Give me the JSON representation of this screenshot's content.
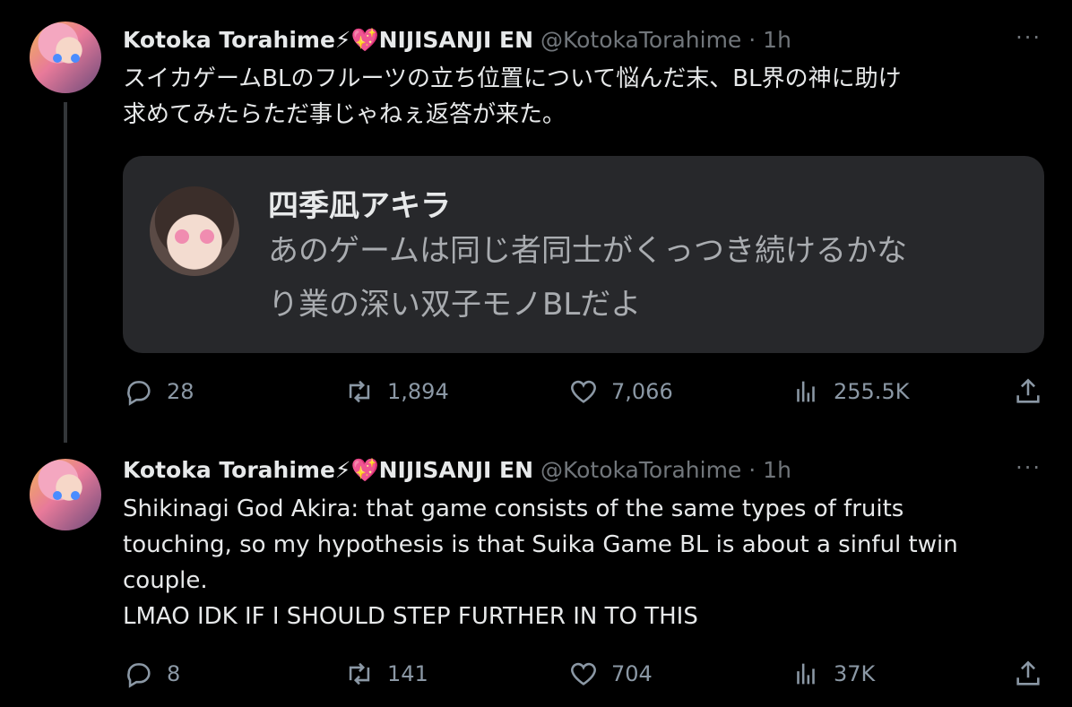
{
  "tweets": [
    {
      "author_name": "Kotoka Torahime⚡💖NIJISANJI EN",
      "handle": "@KotokaTorahime",
      "separator": "·",
      "time": "1h",
      "more": "···",
      "text_lines": [
        "スイカゲームBLのフルーツの立ち位置について悩んだ末、BL界の神に助け",
        "求めてみたらただ事じゃねぇ返答が来た。"
      ],
      "quote": {
        "name": "四季凪アキラ",
        "text_lines": [
          "あのゲームは同じ者同士がくっつき続けるかな",
          "り業の深い双子モノBLだよ"
        ]
      },
      "stats": {
        "replies": "28",
        "retweets": "1,894",
        "likes": "7,066",
        "views": "255.5K"
      }
    },
    {
      "author_name": "Kotoka Torahime⚡💖NIJISANJI EN",
      "handle": "@KotokaTorahime",
      "separator": "·",
      "time": "1h",
      "more": "···",
      "text_lines": [
        "Shikinagi God Akira: that game consists of the same types of fruits",
        "touching, so my hypothesis is that Suika Game BL is about a sinful twin",
        "couple.",
        "LMAO IDK IF I SHOULD STEP FURTHER IN TO THIS"
      ],
      "stats": {
        "replies": "8",
        "retweets": "141",
        "likes": "704",
        "views": "37K"
      }
    }
  ],
  "icons": {
    "reply": "reply-icon",
    "retweet": "retweet-icon",
    "like": "heart-icon",
    "views": "views-icon",
    "share": "share-icon"
  },
  "colors": {
    "background": "#000000",
    "text": "#e7e9ea",
    "muted": "#71767b",
    "quote_bg": "#27282b"
  }
}
